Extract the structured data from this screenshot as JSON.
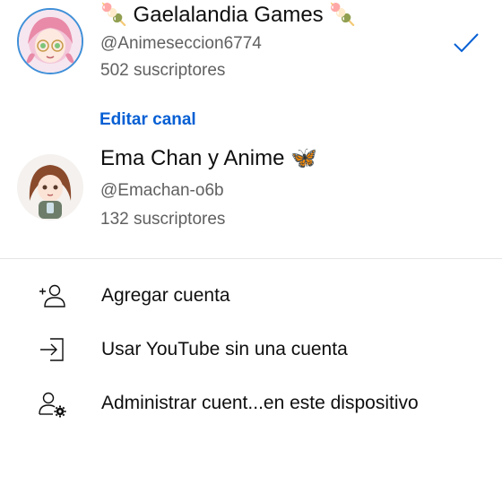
{
  "accounts": [
    {
      "name": "🍡 Gaelalandia Games 🍡",
      "handle": "@Animeseccion6774",
      "subscribers": "502 suscriptores",
      "selected": true,
      "avatar_icon": "anime-girl-avatar"
    },
    {
      "name": "Ema Chan y Anime 🦋",
      "handle": "@Emachan-o6b",
      "subscribers": "132 suscriptores",
      "selected": false,
      "avatar_icon": "anime-girl-avatar"
    }
  ],
  "edit_channel_label": "Editar canal",
  "menu": [
    {
      "label": "Agregar cuenta",
      "icon": "add-person-icon"
    },
    {
      "label": "Usar YouTube sin una cuenta",
      "icon": "sign-in-arrow-icon"
    },
    {
      "label": "Administrar cuent...en este dispositivo",
      "icon": "manage-accounts-icon"
    }
  ],
  "colors": {
    "link": "#065fd4",
    "check": "#065fd4",
    "secondary_text": "#606060",
    "divider": "#e5e5e5"
  }
}
